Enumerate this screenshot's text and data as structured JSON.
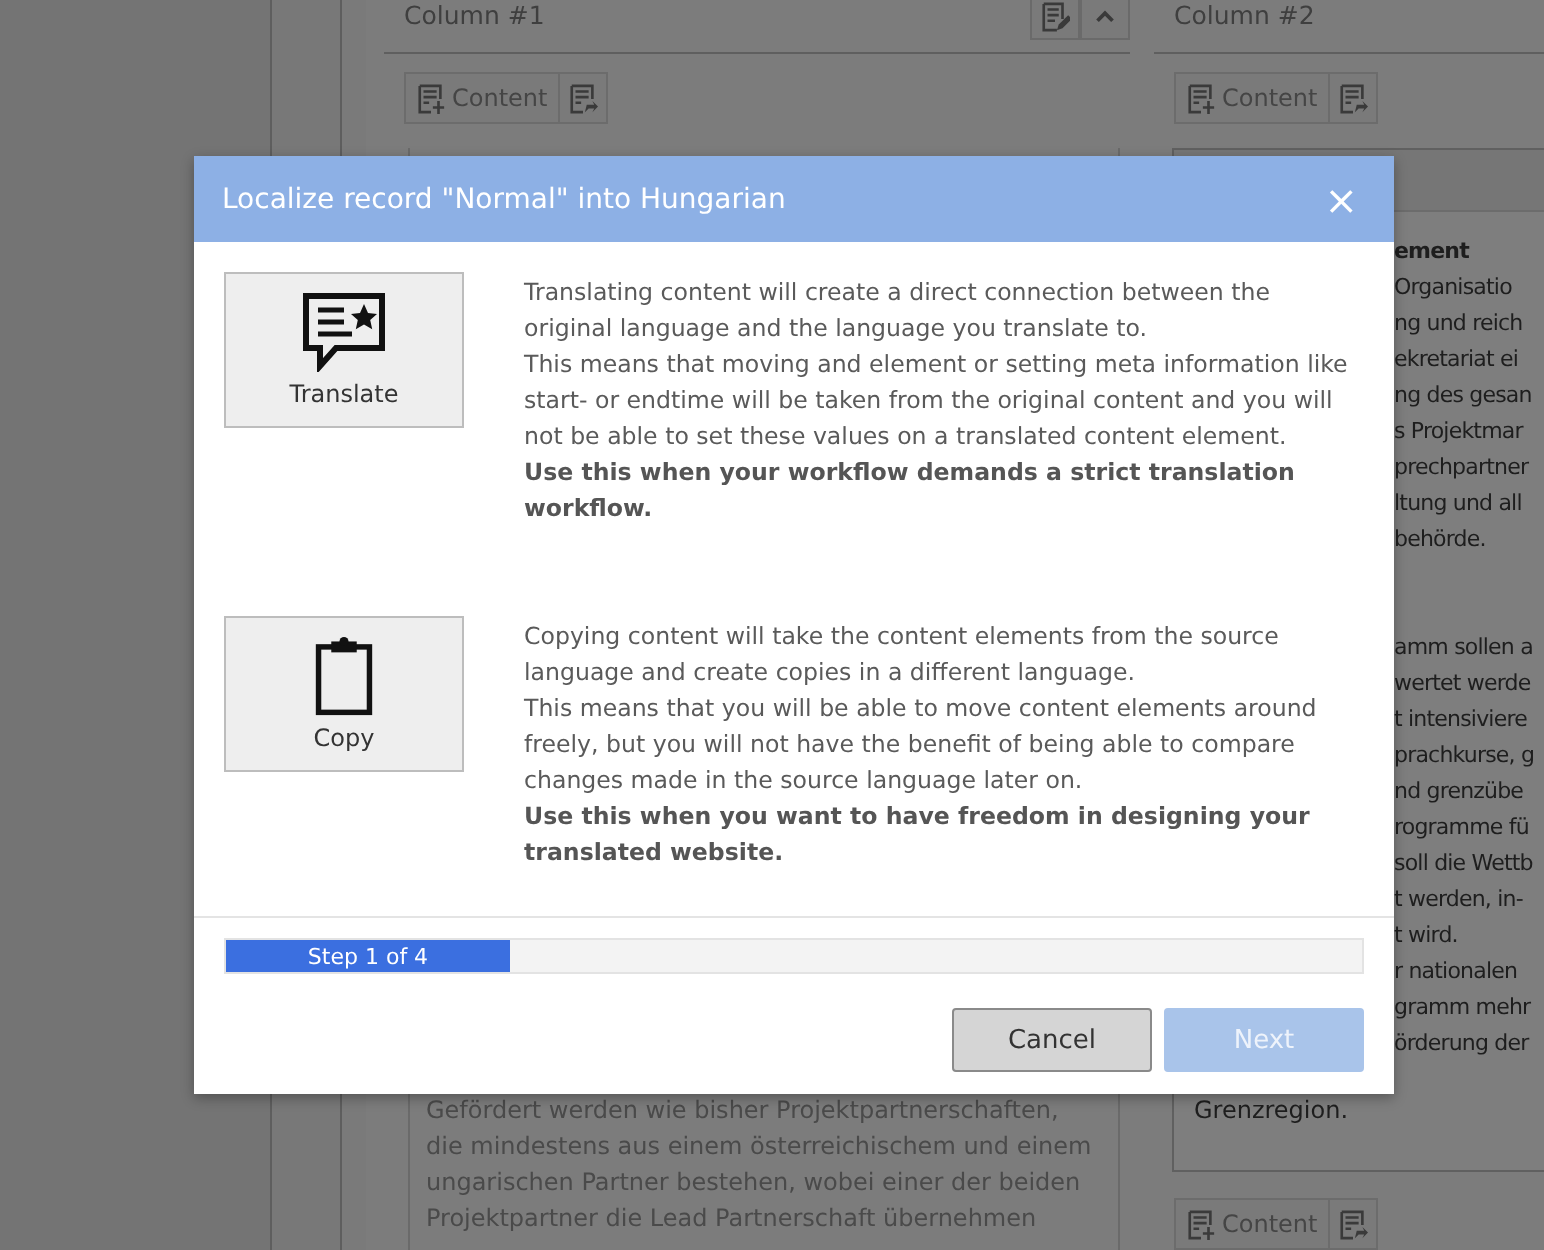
{
  "column_1": {
    "title": "Column #1",
    "content_button": "Content",
    "paragraph": "Gefördert werden wie bisher Projektpartnerschaften, die mindestens aus einem österreichischem und einem ungarischen Partner bestehen, wobei einer der beiden Projektpartner die Lead Partnerschaft übernehmen"
  },
  "column_2": {
    "title": "Column #2",
    "content_button_top": "Content",
    "fragments_top": [
      "ement",
      "Organisatio",
      "ng und reich",
      "ekretariat ei",
      "ng des gesan",
      "s Projektmar",
      "prechpartner",
      "ltung und all",
      "behörde."
    ],
    "fragments_bottom": [
      "amm sollen a",
      "wertet werde",
      "t intensiviere",
      "prachkurse, g",
      "nd grenzübe",
      "rogramme fü",
      "soll die Wettb",
      "t werden, in-",
      "t wird.",
      "r nationalen",
      "gramm mehr",
      "örderung der"
    ],
    "last_line": "Grenzregion.",
    "content_button_bottom": "Content"
  },
  "modal": {
    "title": "Localize record \"Normal\" into Hungarian",
    "close": "×",
    "options": [
      {
        "kind": "translate",
        "label": "Translate",
        "paragraphs": [
          {
            "text": "Translating content will create a direct connection between the original language and the language you translate to.",
            "emphasis": false
          },
          {
            "text": "This means that moving and element or setting meta information like start- or endtime will be taken from the original content and you will not be able to set these values on a translated content element.",
            "emphasis": false
          },
          {
            "text": "Use this when your workflow demands a strict translation workflow.",
            "emphasis": true
          }
        ]
      },
      {
        "kind": "copy",
        "label": "Copy",
        "paragraphs": [
          {
            "text": "Copying content will take the content elements from the source language and create copies in a different language.",
            "emphasis": false
          },
          {
            "text": "This means that you will be able to move content elements around freely, but you will not have the benefit of being able to compare changes made in the source language later on.",
            "emphasis": false
          },
          {
            "text": "Use this when you want to have freedom in designing your translated website.",
            "emphasis": true
          }
        ]
      }
    ],
    "progress": {
      "label": "Step 1 of 4",
      "level": 0.25
    },
    "buttons": [
      {
        "label": "Cancel",
        "disabled": false
      },
      {
        "label": "Next",
        "disabled": true
      }
    ]
  }
}
